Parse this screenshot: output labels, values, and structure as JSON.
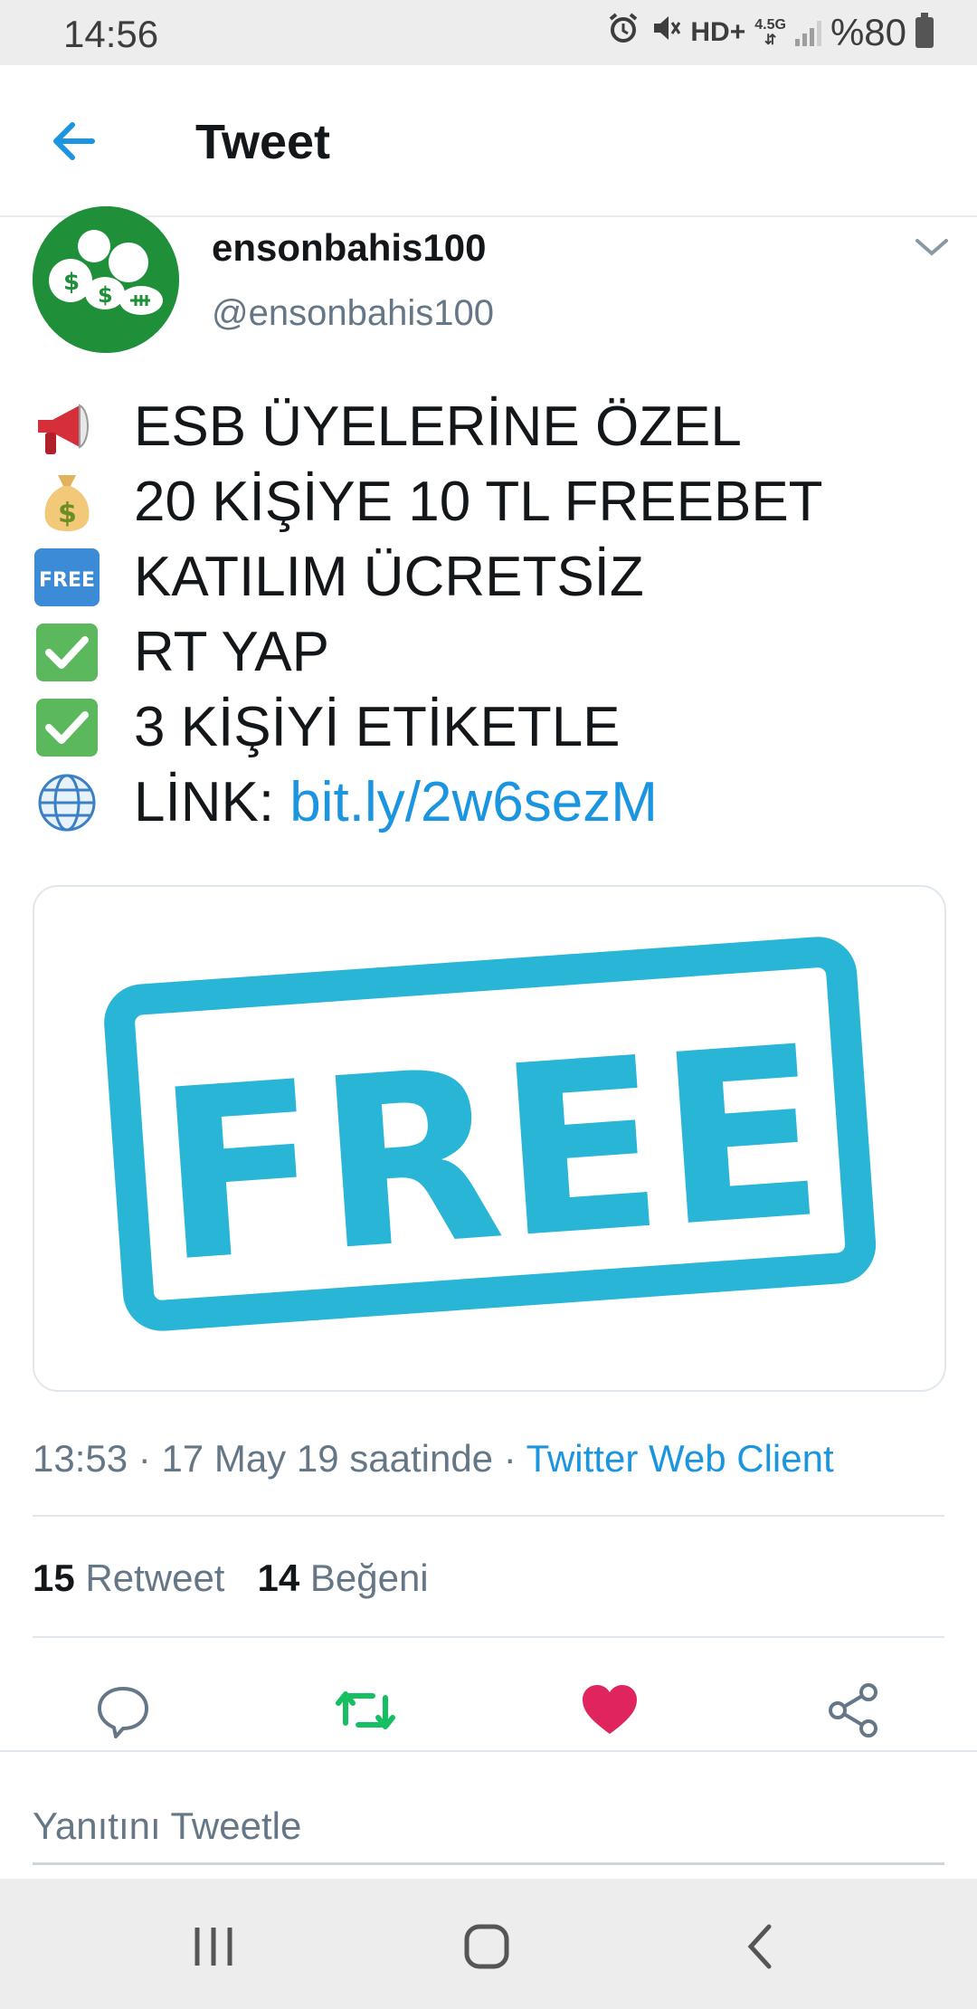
{
  "status_bar": {
    "time": "14:56",
    "network_label": "HD+",
    "network_type": "4.5G",
    "battery_percent": "%80",
    "icons": [
      "alarm-icon",
      "mute-icon",
      "signal-icon",
      "battery-icon"
    ]
  },
  "header": {
    "title": "Tweet",
    "back_icon": "arrow-left-icon"
  },
  "author": {
    "name": "ensonbahis100",
    "handle": "@ensonbahis100",
    "avatar_color": "#1f8f3a"
  },
  "tweet": {
    "lines": [
      {
        "emoji": "megaphone-icon",
        "text": "ESB ÜYELERİNE ÖZEL"
      },
      {
        "emoji": "money-bag-icon",
        "text": "20 KİŞİYE 10 TL FREEBET"
      },
      {
        "emoji": "free-button-icon",
        "emoji_text": "FREE",
        "text": "KATILIM ÜCRETSİZ"
      },
      {
        "emoji": "check-mark-icon",
        "text": "RT YAP"
      },
      {
        "emoji": "check-mark-icon",
        "text": "3 KİŞİYİ ETİKETLE"
      },
      {
        "emoji": "globe-icon",
        "text": "LİNK:",
        "link": "bit.ly/2w6sezM"
      }
    ],
    "media": {
      "stamp_text": "FREE",
      "stamp_color": "#29b6d6"
    }
  },
  "meta": {
    "time": "13:53",
    "separator": "·",
    "date": "17 May 19 saatinde",
    "client": "Twitter Web Client"
  },
  "stats": {
    "retweet_count": "15",
    "retweet_label": "Retweet",
    "like_count": "14",
    "like_label": "Beğeni"
  },
  "actions": {
    "reply_icon": "comment-icon",
    "retweet_icon": "retweet-icon",
    "retweet_color": "#17bf63",
    "like_icon": "heart-icon",
    "like_color": "#e0245e",
    "share_icon": "share-icon"
  },
  "reply": {
    "placeholder": "Yanıtını Tweetle"
  },
  "nav_bar": {
    "icons": [
      "recent-apps-icon",
      "home-icon",
      "back-icon"
    ]
  },
  "colors": {
    "accent": "#1b95e0",
    "text": "#14171a",
    "secondary": "#657786"
  }
}
